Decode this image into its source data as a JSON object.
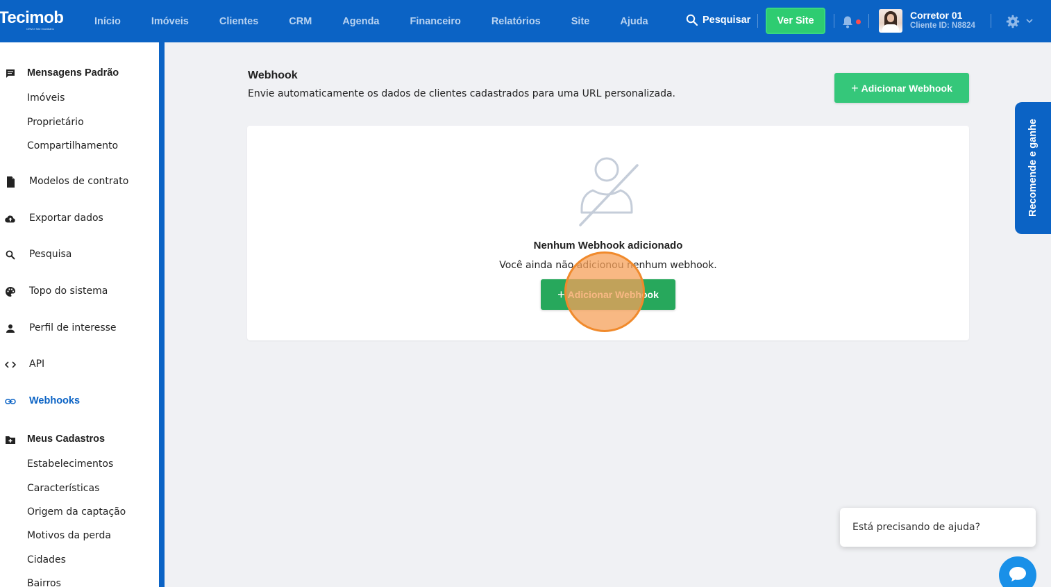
{
  "header": {
    "logo_text": "Tecimob",
    "logo_tagline": "CRM e Site Imobiliário",
    "nav": [
      "Início",
      "Imóveis",
      "Clientes",
      "CRM",
      "Agenda",
      "Financeiro",
      "Relatórios",
      "Site",
      "Ajuda"
    ],
    "search_label": "Pesquisar",
    "ver_site_label": "Ver Site",
    "user_name": "Corretor 01",
    "user_id": "Cliente ID: N8824"
  },
  "sidebar": {
    "mensagens_padrao": "Mensagens Padrão",
    "mensagens_sub": [
      "Imóveis",
      "Proprietário",
      "Compartilhamento"
    ],
    "modelos_contrato": "Modelos de contrato",
    "exportar_dados": "Exportar dados",
    "pesquisa": "Pesquisa",
    "topo_sistema": "Topo do sistema",
    "perfil_interesse": "Perfil de interesse",
    "api": "API",
    "webhooks": "Webhooks",
    "meus_cadastros": "Meus Cadastros",
    "cadastros_sub": [
      "Estabelecimentos",
      "Características",
      "Origem da captação",
      "Motivos da perda",
      "Cidades",
      "Bairros"
    ]
  },
  "main": {
    "title": "Webhook",
    "description": "Envie automaticamente os dados de clientes cadastrados para uma URL personalizada.",
    "add_button": "Adicionar Webhook",
    "empty_title": "Nenhum Webhook adicionado",
    "empty_desc": "Você ainda não adicionou nenhum webhook.",
    "empty_button": "Adicionar Webhook"
  },
  "recommend_tab": "Recomende e ganhe",
  "help": {
    "prompt": "Está precisando de ajuda?"
  },
  "colors": {
    "primary": "#0b63c5",
    "green": "#35c77a",
    "green_dark": "#27a85c",
    "click_indicator": "#f08a2c"
  }
}
